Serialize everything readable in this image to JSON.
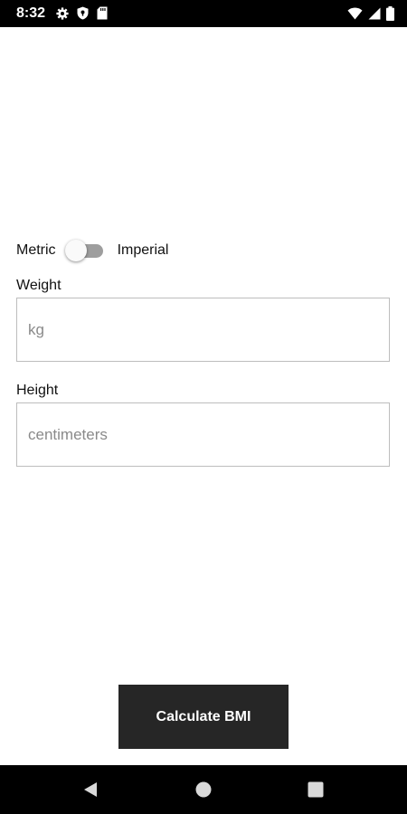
{
  "status_bar": {
    "time": "8:32",
    "icons_left": [
      "gear-icon",
      "shield-icon",
      "sd-card-icon"
    ],
    "icons_right": [
      "wifi-icon",
      "signal-icon",
      "battery-icon"
    ]
  },
  "unit_toggle": {
    "left_label": "Metric",
    "right_label": "Imperial",
    "selected": "Metric"
  },
  "weight": {
    "label": "Weight",
    "value": "",
    "placeholder": "kg"
  },
  "height": {
    "label": "Height",
    "value": "",
    "placeholder": "centimeters"
  },
  "calculate_button": {
    "label": "Calculate BMI"
  },
  "nav_bar": {
    "icons": [
      "back-icon",
      "home-icon",
      "recents-icon"
    ]
  },
  "colors": {
    "status_bar": "#000000",
    "button_bg": "#262626",
    "button_text": "#ffffff",
    "toggle_track": "#9e9e9e",
    "field_border": "#bdbdbd"
  }
}
